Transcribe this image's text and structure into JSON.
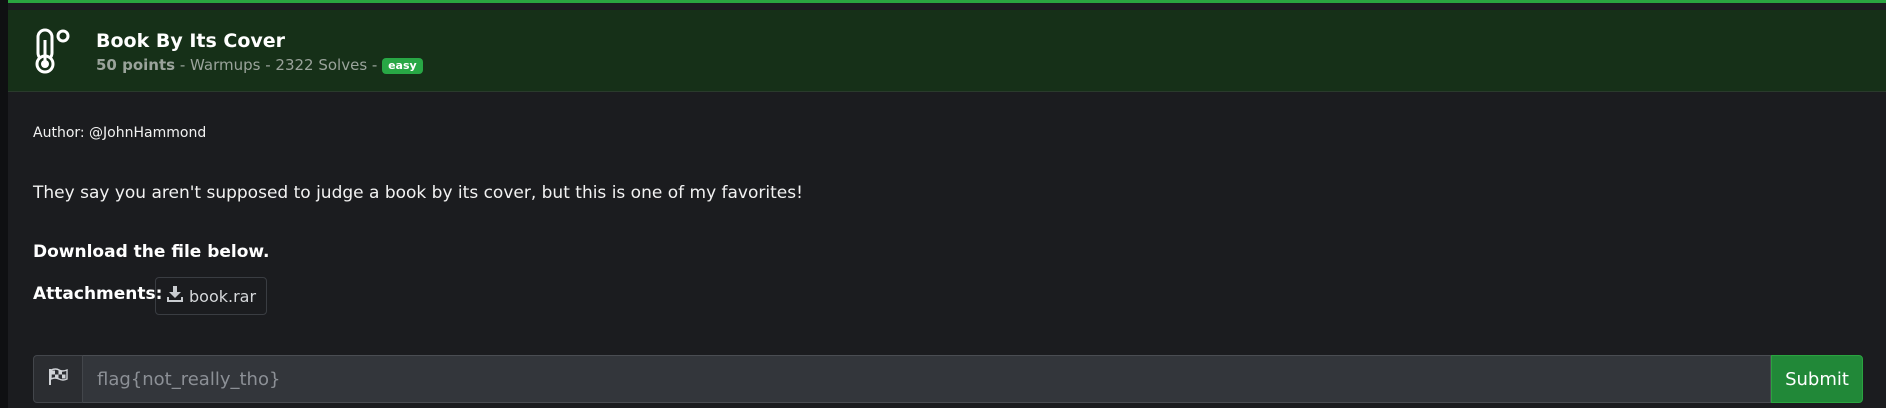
{
  "challenge": {
    "title": "Book By Its Cover",
    "points": "50 points",
    "sep1": " - ",
    "category": "Warmups",
    "sep2": " - ",
    "solves": "2322 Solves",
    "sep3": " - ",
    "difficulty": "easy",
    "icon": "thermometer-icon"
  },
  "body": {
    "author": "Author: @JohnHammond",
    "description": "They say you aren't supposed to judge a book by its cover, but this is one of my favorites!",
    "download_note": "Download the file below.",
    "attachments_label": "Attachments:",
    "attachment_name": "book.rar",
    "attachment_icon": "download-icon"
  },
  "flag_form": {
    "icon": "checkered-flag-icon",
    "placeholder": "flag{not_really_tho}",
    "value": "",
    "submit_label": "Submit"
  },
  "colors": {
    "accent": "#2aa440",
    "header_bg": "#163018",
    "badge": "#28a745",
    "submit": "#218838"
  }
}
